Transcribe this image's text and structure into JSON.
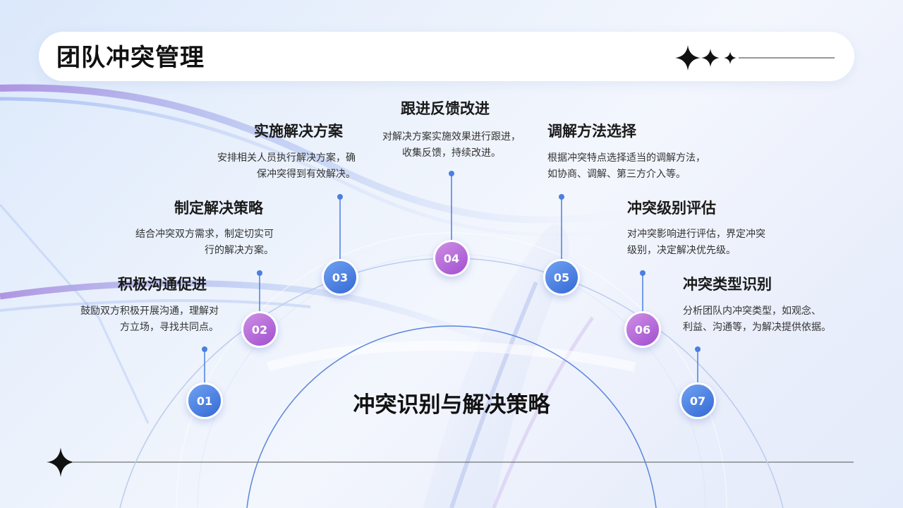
{
  "title": "团队冲突管理",
  "center_label": "冲突识别与解决策略",
  "colors": {
    "blue_node": "#4a7fe3",
    "purple_node": "#b566da",
    "connector": "#4a7fe3"
  },
  "stages": [
    {
      "num": "01",
      "title": "积极沟通促进",
      "desc": [
        "鼓励双方积极开展沟通，理解对",
        "方立场，寻找共同点。"
      ]
    },
    {
      "num": "02",
      "title": "制定解决策略",
      "desc": [
        "结合冲突双方需求，制定切实可",
        "行的解决方案。"
      ]
    },
    {
      "num": "03",
      "title": "实施解决方案",
      "desc": [
        "安排相关人员执行解决方案，确",
        "保冲突得到有效解决。"
      ]
    },
    {
      "num": "04",
      "title": "跟进反馈改进",
      "desc": [
        "对解决方案实施效果进行跟进，",
        "收集反馈，持续改进。"
      ]
    },
    {
      "num": "05",
      "title": "调解方法选择",
      "desc": [
        "根据冲突特点选择适当的调解方法，",
        "如协商、调解、第三方介入等。"
      ]
    },
    {
      "num": "06",
      "title": "冲突级别评估",
      "desc": [
        "对冲突影响进行评估，界定冲突",
        "级别，决定解决优先级。"
      ]
    },
    {
      "num": "07",
      "title": "冲突类型识别",
      "desc": [
        "分析团队内冲突类型，如观念、",
        "利益、沟通等，为解决提供依据。"
      ]
    }
  ]
}
